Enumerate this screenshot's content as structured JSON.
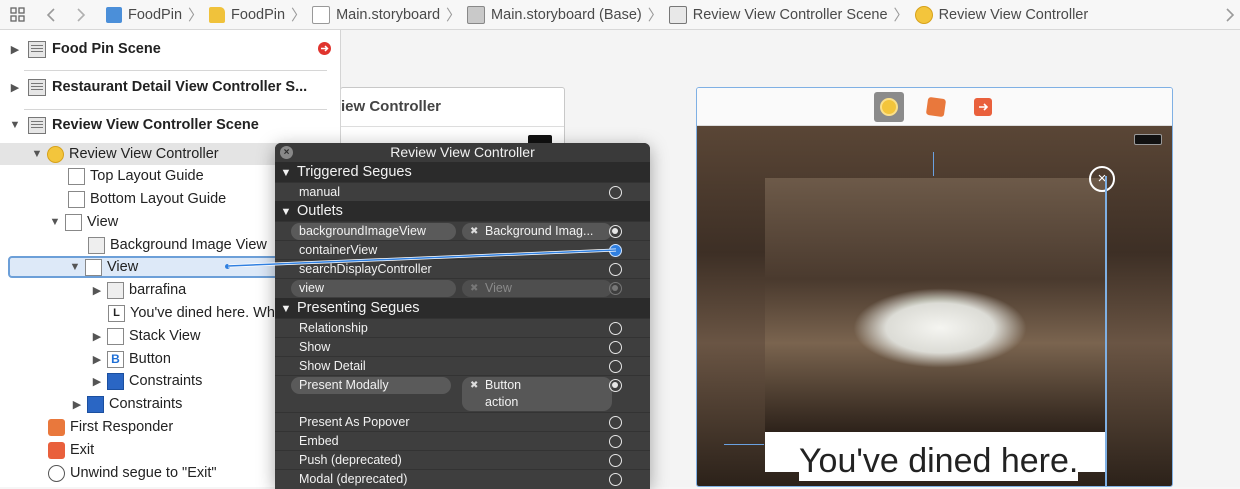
{
  "jumpbar": {
    "crumbs": [
      "FoodPin",
      "FoodPin",
      "Main.storyboard",
      "Main.storyboard (Base)",
      "Review View Controller Scene",
      "Review View Controller"
    ]
  },
  "outline": {
    "scenes": [
      "Food Pin Scene",
      "Restaurant Detail View Controller S...",
      "Review View Controller Scene"
    ],
    "items": {
      "review_vc": "Review View Controller",
      "top_guide": "Top Layout Guide",
      "bottom_guide": "Bottom Layout Guide",
      "view": "View",
      "bg_image": "Background Image View",
      "inner_view": "View",
      "barrafina": "barrafina",
      "dined_label": "You've dined here. Wh",
      "stack_view": "Stack View",
      "button": "Button",
      "constraints_inner": "Constraints",
      "constraints_outer": "Constraints",
      "first_responder": "First Responder",
      "exit": "Exit",
      "unwind": "Unwind segue to \"Exit\""
    },
    "label_glyph": "L",
    "button_glyph": "B"
  },
  "canvas": {
    "left_scene_title": "iew Controller",
    "dined_text": "You've dined here."
  },
  "hud": {
    "title": "Review View Controller",
    "sections": {
      "triggered": "Triggered Segues",
      "outlets": "Outlets",
      "presenting": "Presenting Segues"
    },
    "triggered": {
      "manual": "manual"
    },
    "outlets": {
      "o1": "backgroundImageView",
      "o1_target": "Background Imag...",
      "o2": "containerView",
      "o3": "searchDisplayController",
      "o4": "view",
      "o4_target": "View"
    },
    "presenting": {
      "relationship": "Relationship",
      "show": "Show",
      "show_detail": "Show Detail",
      "present_modally": "Present Modally",
      "pm_target": "Button",
      "pm_target_sub": "action",
      "popover": "Present As Popover",
      "embed": "Embed",
      "push": "Push (deprecated)",
      "modal": "Modal (deprecated)"
    }
  },
  "colors": {
    "accent": "#2f7fe0",
    "selection": "#dde9f8",
    "hud_bg": "#2b2b2b",
    "error": "#e0342e"
  }
}
